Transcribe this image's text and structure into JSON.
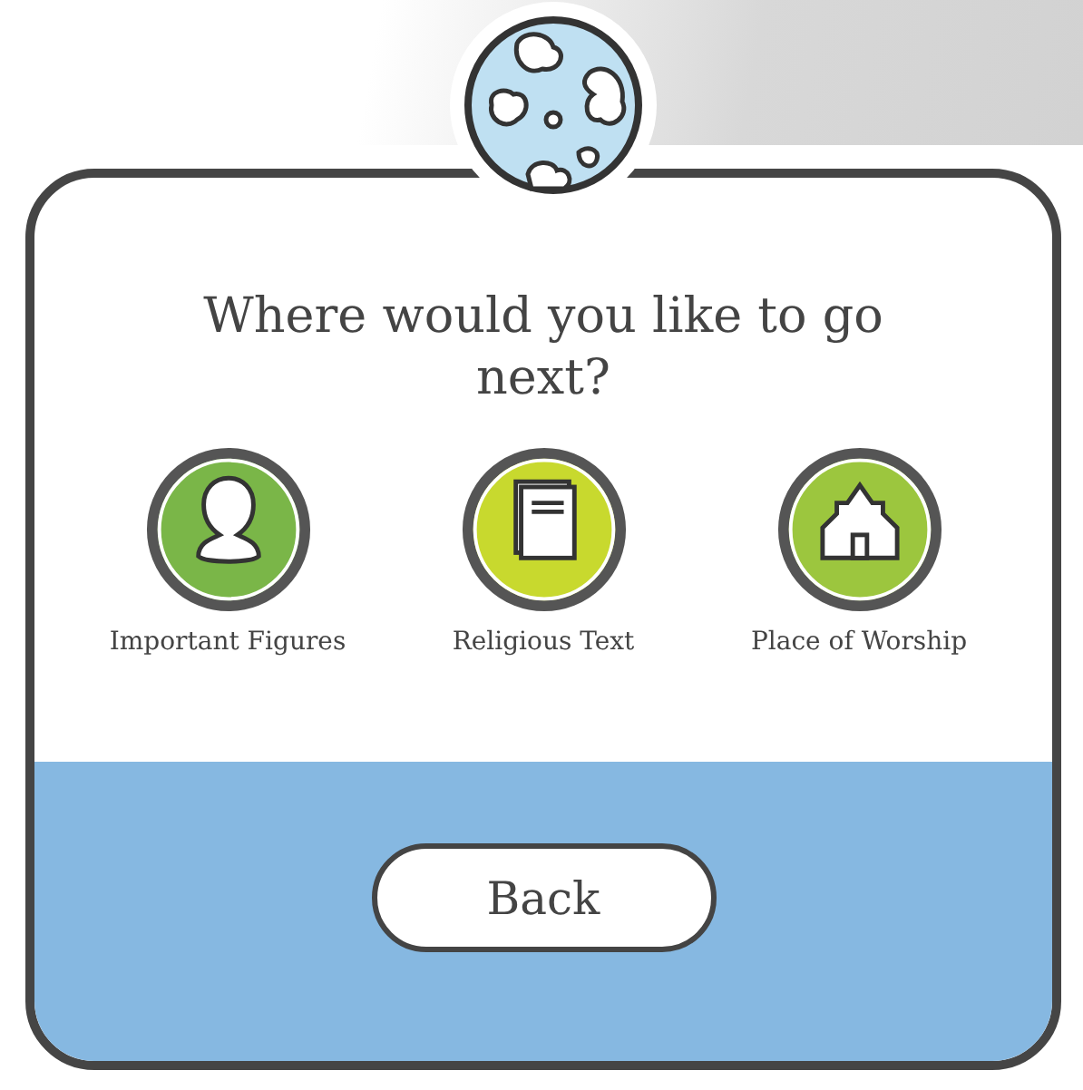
{
  "heading": "Where would you like to go next?",
  "options": [
    {
      "label": "Important Figures",
      "kind": "person",
      "color": "#7ab648"
    },
    {
      "label": "Religious Text",
      "kind": "book",
      "color": "#c8d92e"
    },
    {
      "label": "Place of Worship",
      "kind": "house",
      "color": "#9cc63e"
    }
  ],
  "back_button": "Back"
}
